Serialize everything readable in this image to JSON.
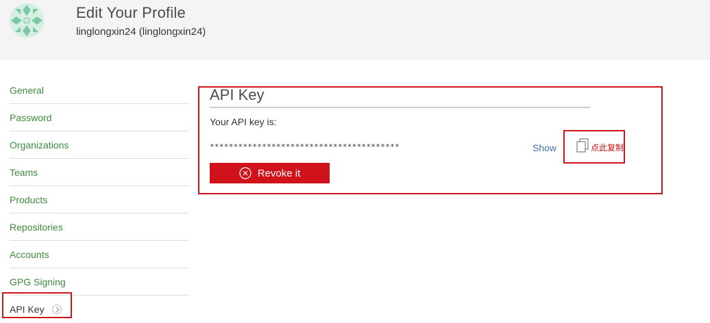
{
  "header": {
    "title": "Edit Your Profile",
    "username": "linglongxin24 (linglongxin24)"
  },
  "sidebar": {
    "items": [
      {
        "label": "General"
      },
      {
        "label": "Password"
      },
      {
        "label": "Organizations"
      },
      {
        "label": "Teams"
      },
      {
        "label": "Products"
      },
      {
        "label": "Repositories"
      },
      {
        "label": "Accounts"
      },
      {
        "label": "GPG Signing"
      },
      {
        "label": "API Key",
        "active": true
      }
    ]
  },
  "api_key_panel": {
    "title": "API Key",
    "label": "Your API key is:",
    "masked_key": "****************************************",
    "show_label": "Show",
    "copy_label": "点此复制",
    "revoke_label": "Revoke it"
  },
  "colors": {
    "accent_red": "#d0121a",
    "link_green": "#3b8b3b",
    "link_blue": "#4a6fa5",
    "header_bg": "#f4f4f4"
  },
  "icons": {
    "avatar": "identicon-avatar",
    "chevron": "chevron-right-icon",
    "copy": "copy-icon",
    "revoke": "close-circle-icon"
  }
}
